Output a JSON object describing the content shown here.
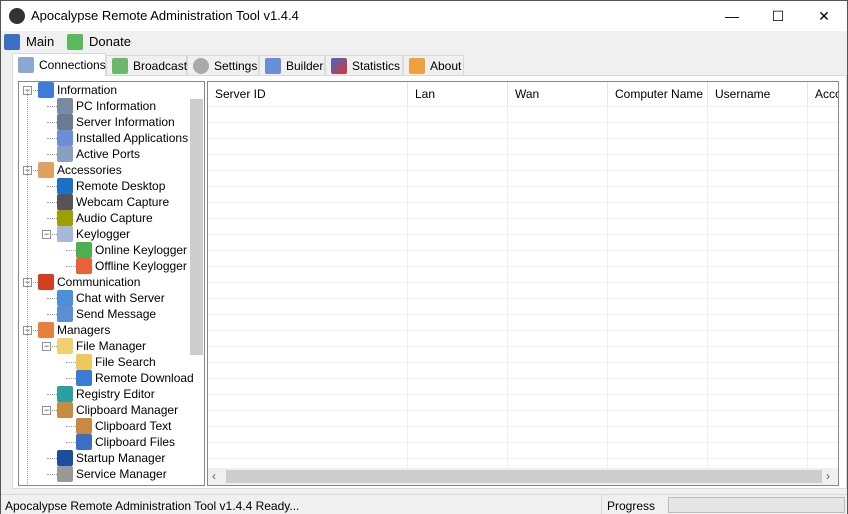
{
  "window": {
    "title": "Apocalypse Remote Administration Tool v1.4.4",
    "minimize": "—",
    "maximize": "☐",
    "close": "✕"
  },
  "menu": [
    {
      "label": "Main",
      "icon": "monitor-icon",
      "color": "#3a6fc4"
    },
    {
      "label": "Donate",
      "icon": "money-icon",
      "color": "#5cb85c"
    }
  ],
  "tabs": [
    {
      "label": "Connections",
      "icon": "server-icon",
      "active": true
    },
    {
      "label": "Broadcast",
      "icon": "broadcast-icon"
    },
    {
      "label": "Settings",
      "icon": "gear-icon"
    },
    {
      "label": "Builder",
      "icon": "wrench-icon"
    },
    {
      "label": "Statistics",
      "icon": "chart-icon"
    },
    {
      "label": "About",
      "icon": "star-icon"
    }
  ],
  "tree": [
    {
      "label": "Information",
      "level": 0,
      "expanded": true,
      "icon": "info-icon",
      "color": "#3b7dd8"
    },
    {
      "label": "PC Information",
      "level": 1,
      "icon": "computer-icon",
      "color": "#7a8aa0"
    },
    {
      "label": "Server Information",
      "level": 1,
      "icon": "server-info-icon",
      "color": "#6a7a90"
    },
    {
      "label": "Installed Applications",
      "level": 1,
      "icon": "applications-icon",
      "color": "#6b8fd6"
    },
    {
      "label": "Active Ports",
      "level": 1,
      "icon": "ports-icon",
      "color": "#8aa0c0"
    },
    {
      "label": "Accessories",
      "level": 0,
      "expanded": true,
      "icon": "user-icon",
      "color": "#e0a060"
    },
    {
      "label": "Remote Desktop",
      "level": 1,
      "icon": "desktop-icon",
      "color": "#1e6fc8"
    },
    {
      "label": "Webcam Capture",
      "level": 1,
      "icon": "webcam-icon",
      "color": "#555555"
    },
    {
      "label": "Audio Capture",
      "level": 1,
      "icon": "speaker-icon",
      "color": "#9aa000"
    },
    {
      "label": "Keylogger",
      "level": 1,
      "expanded": true,
      "icon": "keyboard-icon",
      "color": "#a8b8d8"
    },
    {
      "label": "Online Keylogger",
      "level": 2,
      "icon": "keyboard-online-icon",
      "color": "#4caf50"
    },
    {
      "label": "Offline Keylogger",
      "level": 2,
      "icon": "keyboard-offline-icon",
      "color": "#e8603c"
    },
    {
      "label": "Communication",
      "level": 0,
      "expanded": true,
      "icon": "antenna-icon",
      "color": "#d04020"
    },
    {
      "label": "Chat with Server",
      "level": 1,
      "icon": "chat-icon",
      "color": "#4a90d9"
    },
    {
      "label": "Send Message",
      "level": 1,
      "icon": "mail-icon",
      "color": "#5a8fd0"
    },
    {
      "label": "Managers",
      "level": 0,
      "expanded": true,
      "icon": "wrench-icon",
      "color": "#e87f3c"
    },
    {
      "label": "File Manager",
      "level": 1,
      "expanded": true,
      "icon": "folder-icon",
      "color": "#f0d070"
    },
    {
      "label": "File Search",
      "level": 2,
      "icon": "folder-search-icon",
      "color": "#f0c860"
    },
    {
      "label": "Remote Download",
      "level": 2,
      "icon": "download-icon",
      "color": "#3a7bd5"
    },
    {
      "label": "Registry Editor",
      "level": 1,
      "icon": "registry-icon",
      "color": "#2aa0a0"
    },
    {
      "label": "Clipboard Manager",
      "level": 1,
      "expanded": true,
      "icon": "clipboard-icon",
      "color": "#c88a40"
    },
    {
      "label": "Clipboard Text",
      "level": 2,
      "icon": "clipboard-text-icon",
      "color": "#c88a40"
    },
    {
      "label": "Clipboard Files",
      "level": 2,
      "icon": "clipboard-files-icon",
      "color": "#3a6fc4"
    },
    {
      "label": "Startup Manager",
      "level": 1,
      "icon": "windows-icon",
      "color": "#1a4fa0"
    },
    {
      "label": "Service Manager",
      "level": 1,
      "icon": "gear-icon",
      "color": "#999999"
    }
  ],
  "grid": {
    "columns": [
      "Server ID",
      "Lan",
      "Wan",
      "Computer Name",
      "Username",
      "Acco"
    ],
    "rows": []
  },
  "status": {
    "text": "Apocalypse Remote Administration Tool v1.4.4 Ready...",
    "progress_label": "Progress",
    "progress": 0
  }
}
